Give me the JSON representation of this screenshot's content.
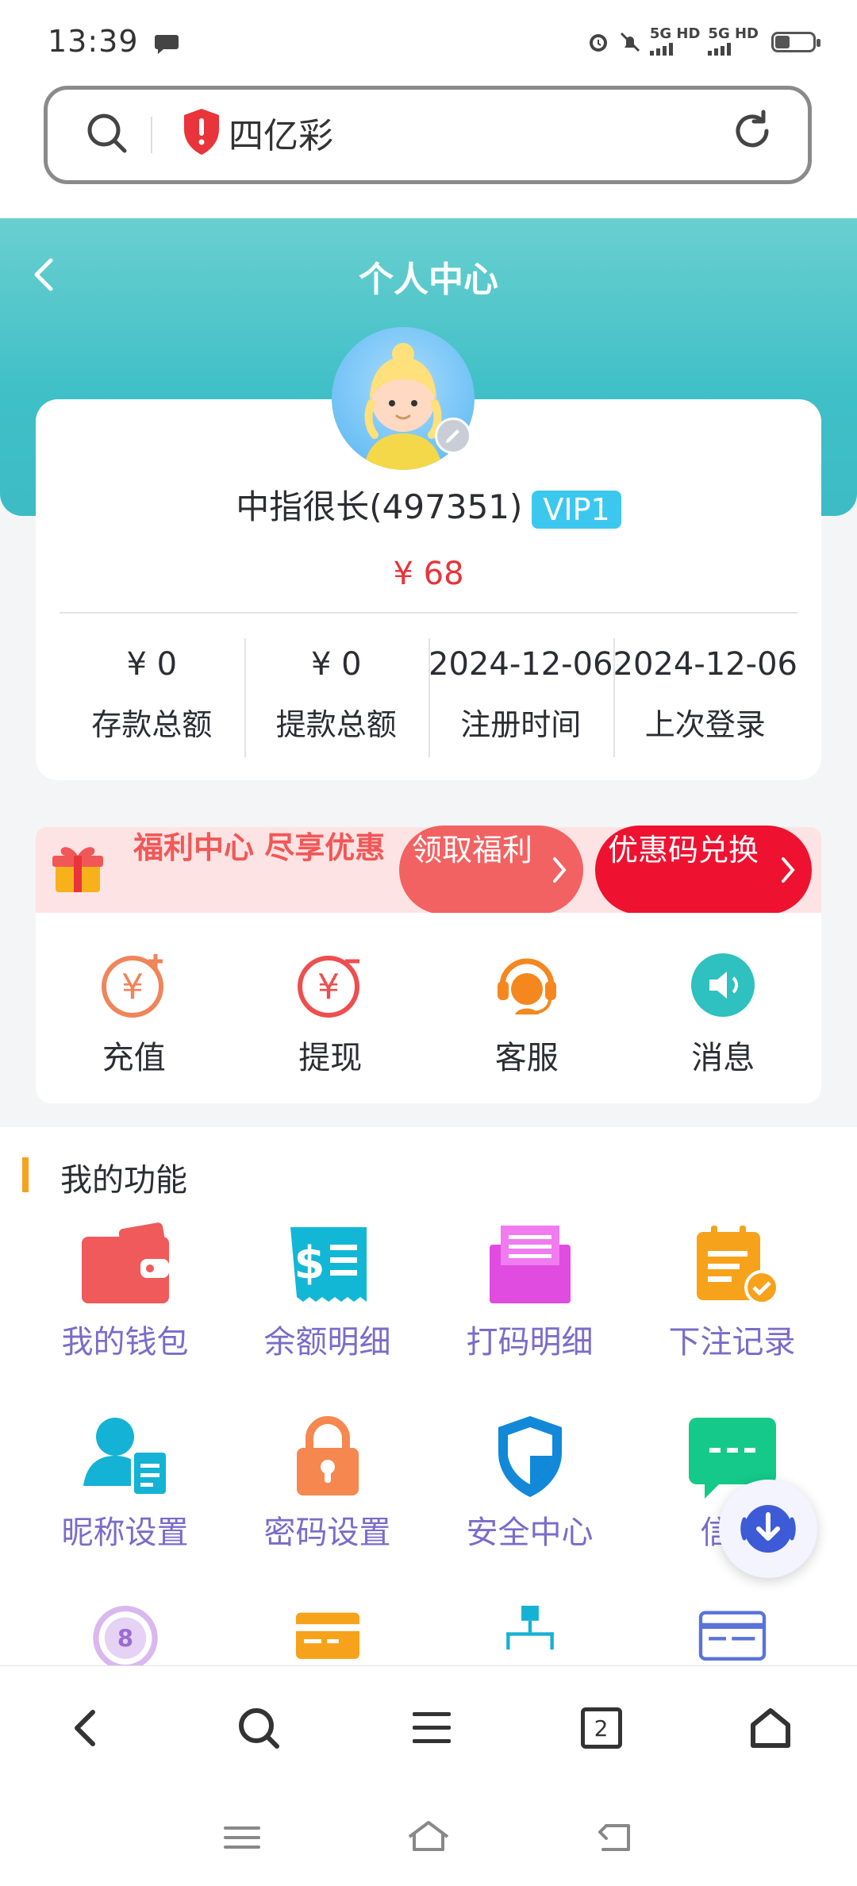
{
  "status": {
    "time": "13:39",
    "sig1": "5G HD",
    "sig2": "5G HD"
  },
  "browser": {
    "address_text": "四亿彩",
    "tab_count": "2"
  },
  "header": {
    "title": "个人中心"
  },
  "profile": {
    "name": "中指很长(497351)",
    "vip": "VIP1",
    "balance": "¥ 68",
    "stats": [
      {
        "value": "¥ 0",
        "label": "存款总额"
      },
      {
        "value": "¥ 0",
        "label": "提款总额"
      },
      {
        "value": "2024-12-06",
        "label": "注册时间"
      },
      {
        "value": "2024-12-06",
        "label": "上次登录"
      }
    ]
  },
  "welfare": {
    "text": "福利中心 尽享优惠",
    "claim_button": "领取福利",
    "coupon_button": "优惠码兑换"
  },
  "quick_actions": [
    {
      "label": "充值",
      "icon": "recharge-icon"
    },
    {
      "label": "提现",
      "icon": "withdraw-icon"
    },
    {
      "label": "客服",
      "icon": "customer-service-icon"
    },
    {
      "label": "消息",
      "icon": "message-icon"
    }
  ],
  "functions": {
    "title": "我的功能",
    "items": [
      {
        "label": "我的钱包",
        "icon": "wallet-icon"
      },
      {
        "label": "余额明细",
        "icon": "balance-detail-icon"
      },
      {
        "label": "打码明细",
        "icon": "bet-code-icon"
      },
      {
        "label": "下注记录",
        "icon": "bet-record-icon"
      },
      {
        "label": "昵称设置",
        "icon": "nickname-icon"
      },
      {
        "label": "密码设置",
        "icon": "password-icon"
      },
      {
        "label": "安全中心",
        "icon": "security-icon"
      },
      {
        "label": "信息",
        "icon": "info-icon"
      }
    ]
  },
  "colors": {
    "teal": "#3fbfc7",
    "red": "#e8343a",
    "accent_orange": "#f7a21b",
    "func_label": "#7a6cc9"
  }
}
